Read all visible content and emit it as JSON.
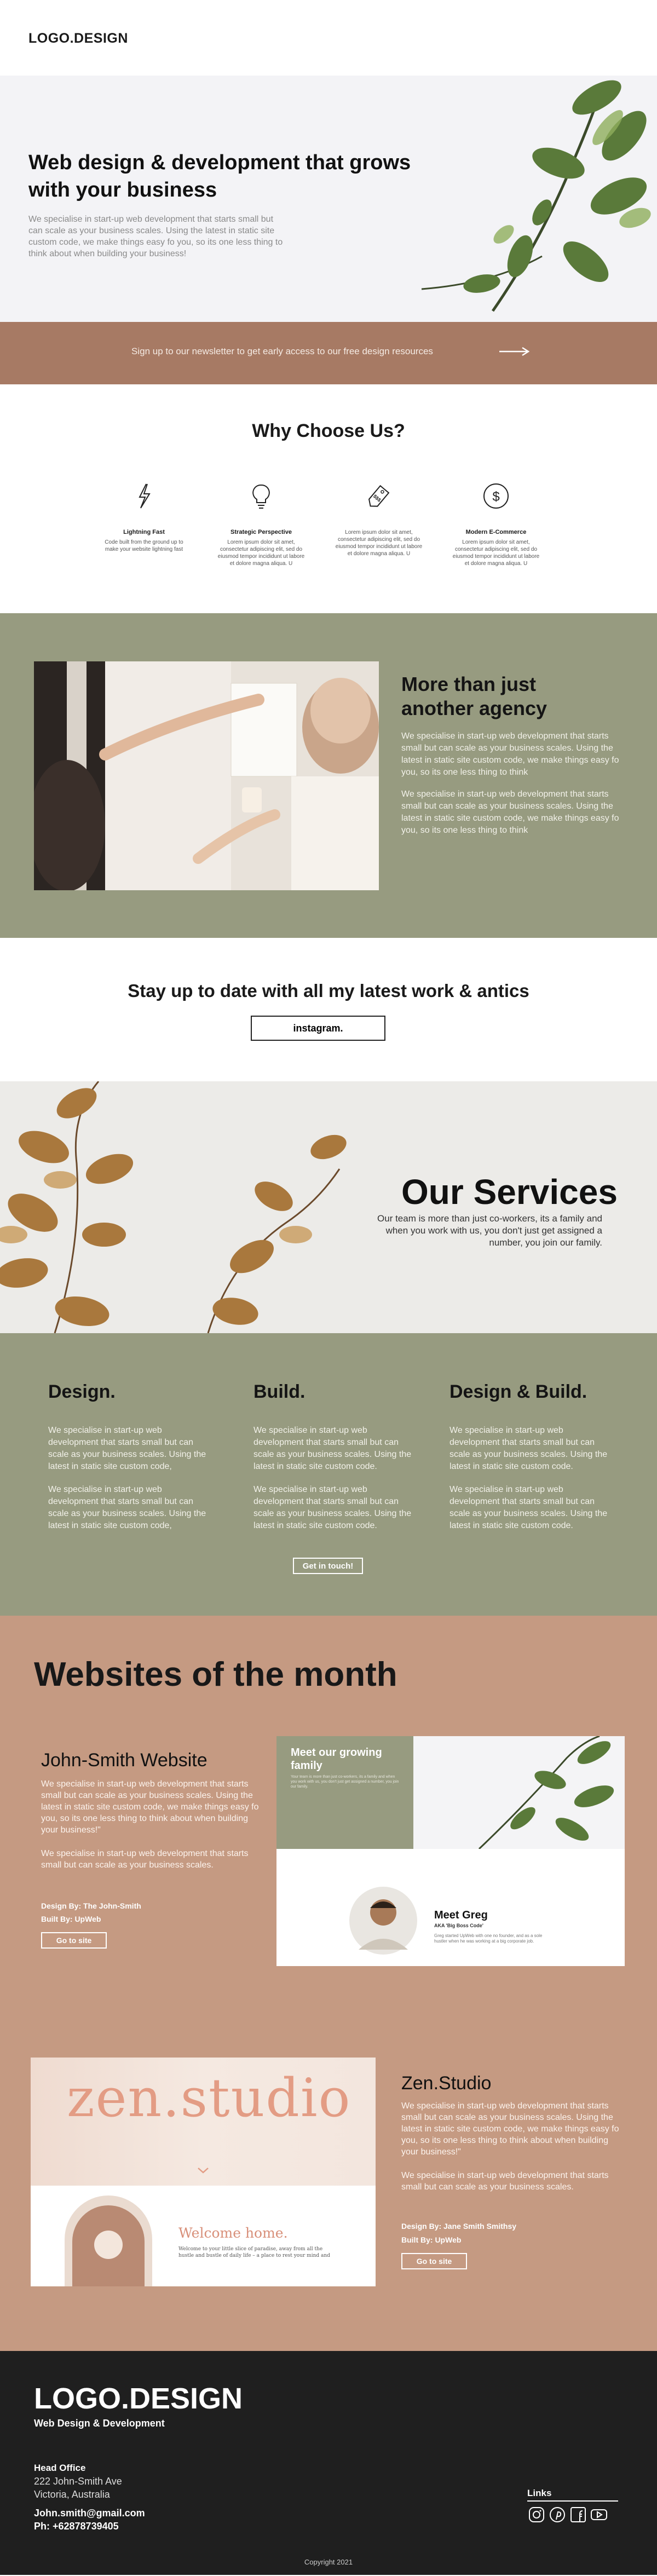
{
  "header": {
    "logo": "LOGO.DESIGN"
  },
  "hero": {
    "title": "Web design & development that grows with your business",
    "text": "We specialise in start-up web development that starts small but can scale as your business scales. Using the latest in static site custom code, we make things easy fo you, so its one less thing to think about when building your business!"
  },
  "newsletter": {
    "text": "Sign up to our newsletter to get early access to our free design resources",
    "arrow_icon": "arrow-right-icon"
  },
  "why": {
    "title": "Why Choose Us?",
    "features": [
      {
        "icon": "lightning-icon",
        "title": "Lightning Fast",
        "text": "Code built from the ground up to make your website lightning fast"
      },
      {
        "icon": "lightbulb-icon",
        "title": "Strategic Perspective",
        "text": "Lorem ipsum dolor sit amet, consectetur adipiscing elit, sed do eiusmod tempor incididunt ut labore et dolore magna aliqua. U"
      },
      {
        "icon": "price-tag-icon",
        "title": "",
        "text": "Lorem ipsum dolor sit amet, consectetur adipiscing elit, sed do eiusmod tempor incididunt ut labore et dolore magna aliqua. U"
      },
      {
        "icon": "dollar-icon",
        "title": "Modern E-Commerce",
        "text": "Lorem ipsum dolor sit amet, consectetur adipiscing elit, sed do eiusmod tempor incididunt ut labore et dolore magna aliqua. U"
      }
    ]
  },
  "agency": {
    "title": "More than just another agency",
    "p1": "We specialise in start-up web development that starts small but can scale as your business scales. Using the latest in static site custom code, we make things easy fo you, so its one less thing to think",
    "p2": "We specialise in start-up web development that starts small but can scale as your business scales. Using the latest in static site custom code, we make things easy fo you, so its one less thing to think"
  },
  "insta": {
    "title": "Stay up to date with all my latest work & antics",
    "button": "instagram."
  },
  "services": {
    "title": "Our Services",
    "text": "Our team is more than just co-workers, its a family and when you work with us, you don't just get assigned a number, you join our family.",
    "columns": [
      {
        "title": "Design.",
        "t1": "We specialise in start-up web development that starts small but can scale as your business scales. Using the latest in static site custom code,",
        "t2": "We specialise in start-up web development that starts small but can scale as your business scales. Using the latest in static site custom code,"
      },
      {
        "title": "Build.",
        "t1": "We specialise in start-up web development that starts small but can scale as your business scales. Using the latest in static site custom code.",
        "t2": "We specialise in start-up web development that starts small but can scale as your business scales. Using the latest in static site custom code."
      },
      {
        "title": "Design & Build.",
        "t1": "We specialise in start-up web development that starts small but can scale as your business scales. Using the latest in static site custom code.",
        "t2": "We specialise in start-up web development that starts small but can scale as your business scales. Using the latest in static site custom code."
      }
    ],
    "cta": "Get in touch!"
  },
  "websites": {
    "title": "Websites of the month",
    "site1": {
      "name": "John-Smith Website",
      "p1": "We specialise in start-up web development that starts small but can scale as your business scales. Using the latest in static site custom code, we make things easy fo you, so its one less thing to think about when building your business!\"",
      "p2": "We specialise in start-up web development that starts small but can scale as your business scales.",
      "designer": "Design By: The John-Smith",
      "builder": "Built By: UpWeb",
      "button": "Go to site",
      "mock": {
        "heading": "Meet our growing family",
        "blurb": "Your team is more than just co-workers, its a family and when you work with us, you don't just get assigned a number, you join our family.",
        "name": "Meet Greg",
        "role": "AKA 'Big Boss Code'",
        "desc": "Greg started UpWeb with one no founder, and as a sole hustler when he was working at a big corporate job."
      }
    },
    "site2": {
      "name": "Zen.Studio",
      "p1": "We specialise in start-up web development that starts small but can scale as your business scales. Using the latest in static site custom code, we make things easy fo you, so its one less thing to think about when building your business!\"",
      "p2": "We specialise in start-up web development that starts small but can scale as your business scales.",
      "designer": "Design By: Jane Smith Smithsy",
      "builder": "Built By: UpWeb",
      "button": "Go to site",
      "mock": {
        "logo": "zen.studio",
        "welcome": "Welcome home.",
        "sub": "Welcome to your little slice of paradise, away from all the hustle and bustle of daily life – a place to rest your mind and"
      }
    }
  },
  "footer": {
    "logo": "LOGO.DESIGN",
    "tagline": "Web Design & Development",
    "head_office": "Head Office",
    "address1": "222 John-Smith Ave",
    "address2": "Victoria, Australia",
    "email": "John.smith@gmail.com",
    "phone": "Ph: +62878739405",
    "links_title": "Links",
    "social_icons": [
      "instagram-icon",
      "pinterest-icon",
      "facebook-icon",
      "youtube-icon"
    ],
    "copyright": "Copyright 2021"
  },
  "colors": {
    "olive": "#979b80",
    "terracotta": "#a77a64",
    "peach": "#c59a82",
    "dark": "#1f1f1f"
  }
}
